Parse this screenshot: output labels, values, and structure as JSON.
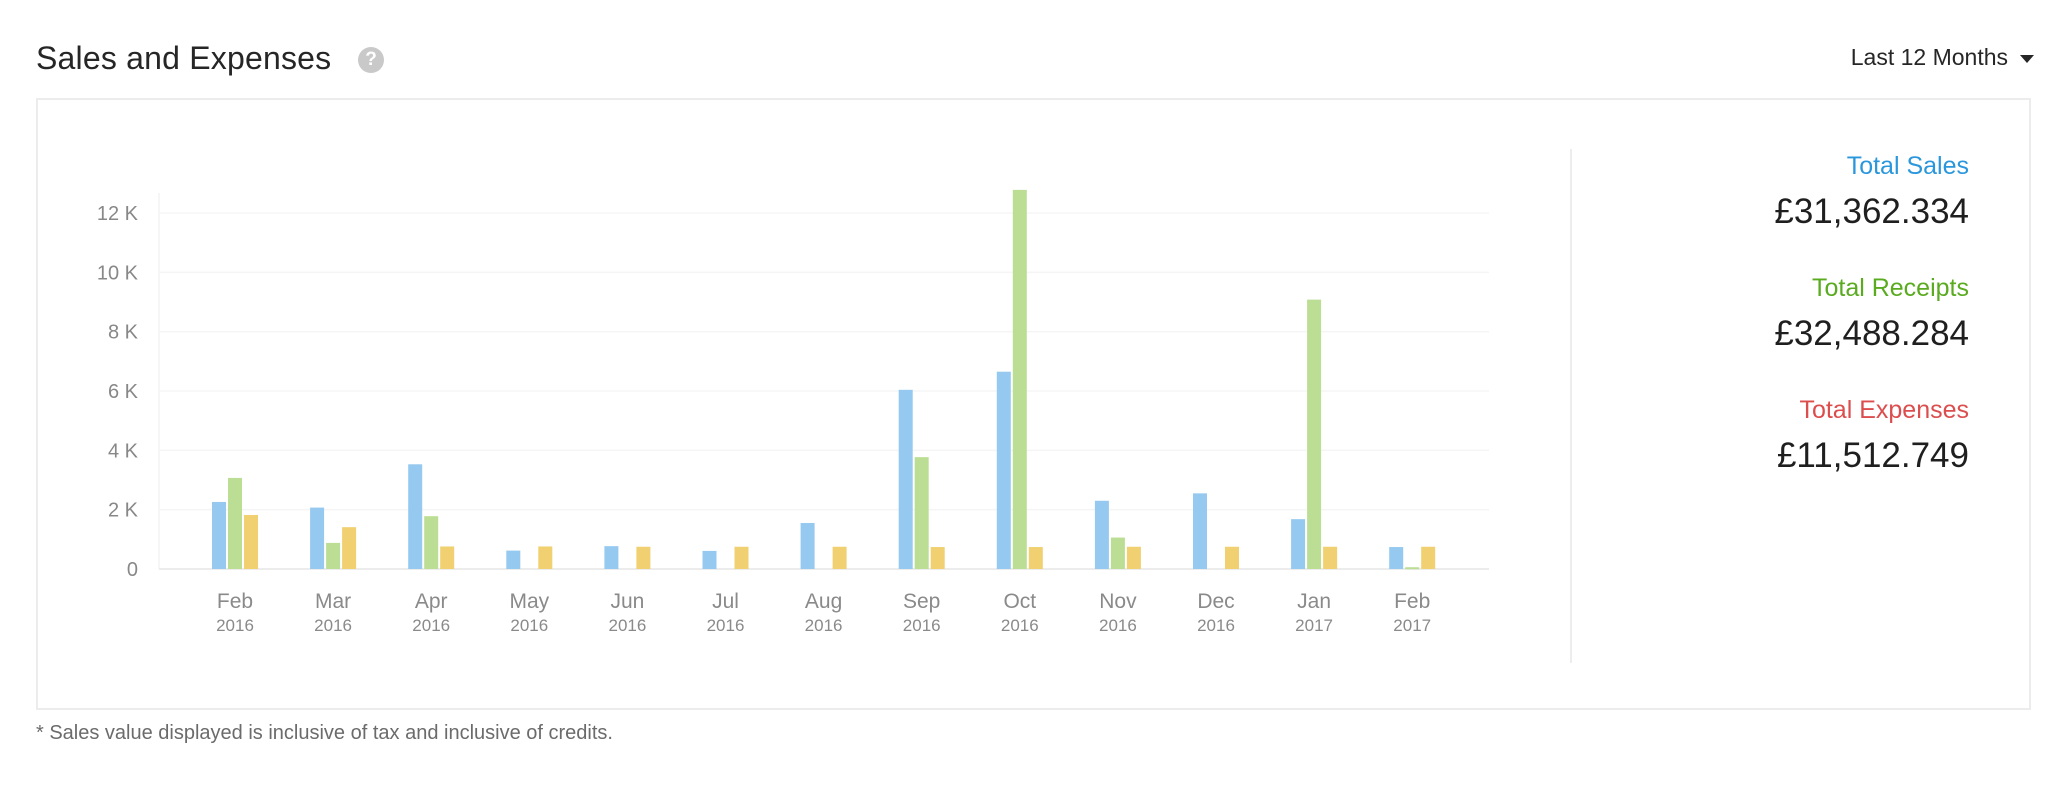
{
  "header": {
    "title": "Sales and Expenses",
    "help_icon": "question-circle-icon",
    "range_selector": {
      "selected": "Last 12 Months",
      "icon": "caret-down-icon"
    }
  },
  "totals": [
    {
      "label": "Total Sales",
      "value": "£31,362.334",
      "color": "#2a97dc"
    },
    {
      "label": "Total Receipts",
      "value": "£32,488.284",
      "color": "#5aab1f"
    },
    {
      "label": "Total Expenses",
      "value": "£11,512.749",
      "color": "#dc4d4d"
    }
  ],
  "footnote": "* Sales value displayed is inclusive of tax and inclusive of credits.",
  "chart_data": {
    "type": "bar",
    "title": "",
    "xlabel": "",
    "ylabel": "",
    "ylim": [
      0,
      12000
    ],
    "grid": true,
    "legend": "none",
    "yticks": [
      0,
      2000,
      4000,
      6000,
      8000,
      10000,
      12000
    ],
    "ytick_labels": [
      "0",
      "2 K",
      "4 K",
      "6 K",
      "8 K",
      "10 K",
      "12 K"
    ],
    "categories": [
      {
        "month": "Feb",
        "year": "2016"
      },
      {
        "month": "Mar",
        "year": "2016"
      },
      {
        "month": "Apr",
        "year": "2016"
      },
      {
        "month": "May",
        "year": "2016"
      },
      {
        "month": "Jun",
        "year": "2016"
      },
      {
        "month": "Jul",
        "year": "2016"
      },
      {
        "month": "Aug",
        "year": "2016"
      },
      {
        "month": "Sep",
        "year": "2016"
      },
      {
        "month": "Oct",
        "year": "2016"
      },
      {
        "month": "Nov",
        "year": "2016"
      },
      {
        "month": "Dec",
        "year": "2016"
      },
      {
        "month": "Jan",
        "year": "2017"
      },
      {
        "month": "Feb",
        "year": "2017"
      }
    ],
    "series": [
      {
        "name": "Sales",
        "color": "#95c9f0",
        "values": [
          2260,
          2070,
          3530,
          620,
          770,
          610,
          1550,
          6040,
          6650,
          2300,
          2550,
          1680,
          740
        ]
      },
      {
        "name": "Receipts",
        "color": "#bbde94",
        "values": [
          3070,
          880,
          1780,
          0,
          0,
          0,
          0,
          3770,
          12780,
          1060,
          0,
          9080,
          60
        ]
      },
      {
        "name": "Expenses",
        "color": "#f0d070",
        "values": [
          1820,
          1410,
          760,
          760,
          750,
          750,
          750,
          740,
          740,
          750,
          750,
          750,
          750
        ]
      }
    ]
  }
}
